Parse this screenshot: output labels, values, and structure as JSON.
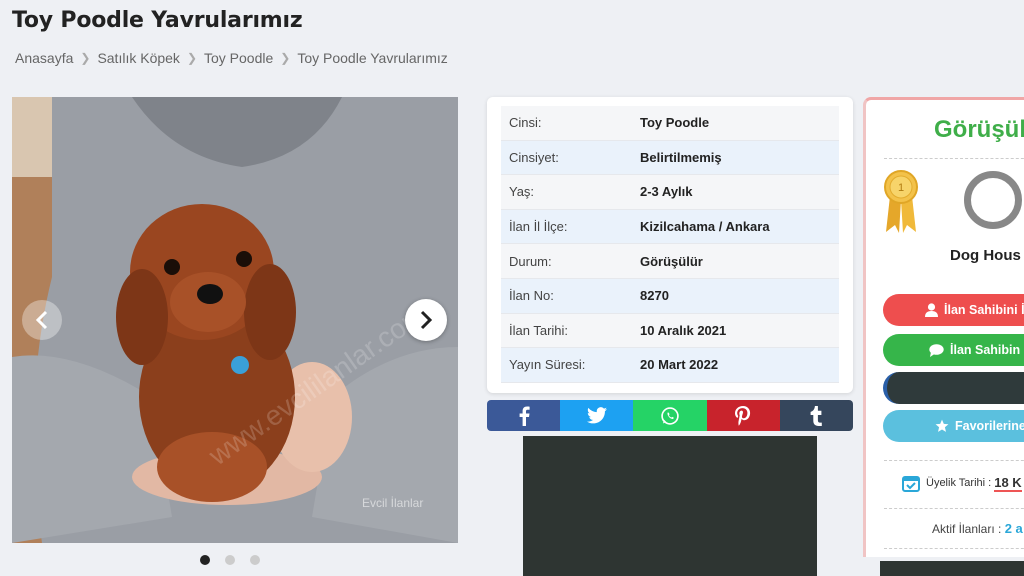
{
  "page": {
    "title": "Toy Poodle Yavrularımız",
    "breadcrumb": [
      "Anasayfa",
      "Satılık Köpek",
      "Toy Poodle",
      "Toy Poodle Yavrularımız"
    ]
  },
  "gallery": {
    "watermark_text": "www.evcililanlar.com",
    "logo_text": "Evcil İlanlar",
    "slides": 3,
    "active_slide": 1
  },
  "info": [
    {
      "label": "Cinsi:",
      "value": "Toy Poodle"
    },
    {
      "label": "Cinsiyet:",
      "value": "Belirtilmemiş"
    },
    {
      "label": "Yaş:",
      "value": "2-3 Aylık"
    },
    {
      "label": "İlan İl İlçe:",
      "value": "Kizilcahama / Ankara"
    },
    {
      "label": "Durum:",
      "value": "Görüşülür"
    },
    {
      "label": "İlan No:",
      "value": "8270"
    },
    {
      "label": "İlan Tarihi:",
      "value": "10 Aralık 2021"
    },
    {
      "label": "Yayın Süresi:",
      "value": "20 Mart 2022"
    }
  ],
  "share": {
    "icons": [
      "facebook-icon",
      "twitter-icon",
      "whatsapp-icon",
      "pinterest-icon",
      "tumblr-icon"
    ],
    "colors": [
      "#3b5998",
      "#1da1f2",
      "#25d366",
      "#c8232c",
      "#35465c"
    ]
  },
  "seller": {
    "title": "Görüşül",
    "badge_number": "1",
    "name": "Dog Hous",
    "btn_owner": "İlan Sahibini İ",
    "btn_message": "İlan Sahibin",
    "btn_favorites": "Favorilerine",
    "member_label": "Üyelik Tarihi :",
    "member_value": "18 K",
    "active_label": "Aktif İlanları :",
    "active_value": "2 a"
  }
}
